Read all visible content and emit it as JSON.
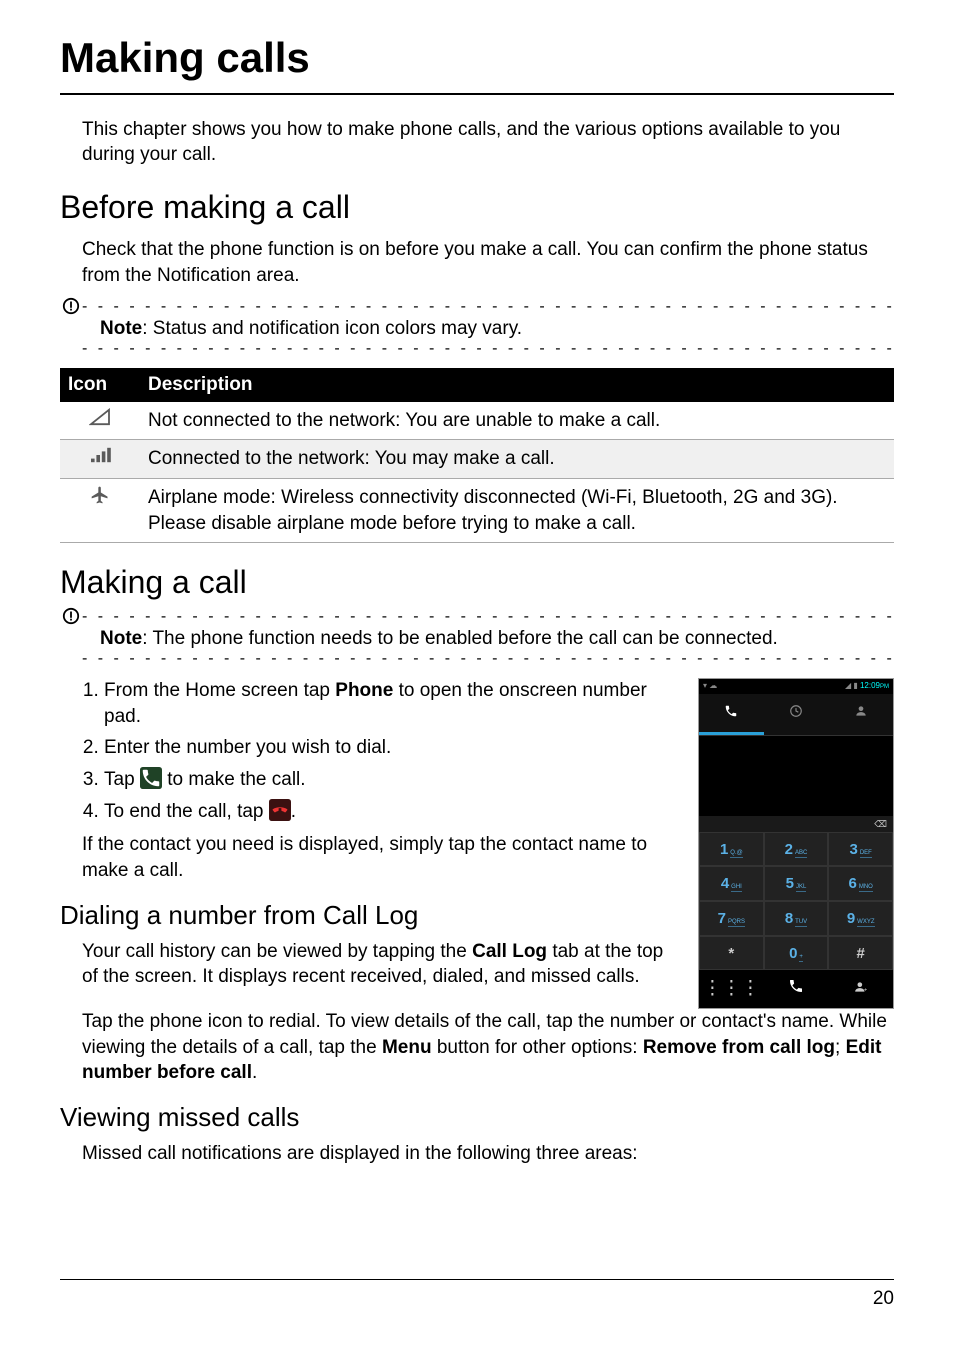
{
  "title": "Making calls",
  "intro": "This chapter shows you how to make phone calls, and the various options available to you during your call.",
  "section_before": {
    "heading": "Before making a call",
    "body": "Check that the phone function is on before you make a call. You can confirm the phone status from the Notification area.",
    "note_label": "Note",
    "note_text": ": Status and notification icon colors may vary."
  },
  "table": {
    "h1": "Icon",
    "h2": "Description",
    "r1": "Not connected to the network: You are unable to make a call.",
    "r2": "Connected to the network: You may make a call.",
    "r3": "Airplane mode: Wireless connectivity disconnected (Wi-Fi, Bluetooth, 2G and 3G). Please disable airplane mode before trying to make a call."
  },
  "section_making": {
    "heading": "Making a call",
    "note_label": "Note",
    "note_text": ": The phone function needs to be enabled before the call can be connected.",
    "step1a": "From the Home screen tap ",
    "step1_bold": "Phone",
    "step1b": " to open the onscreen number pad.",
    "step2": "Enter the number you wish to dial.",
    "step3a": "Tap ",
    "step3b": " to make the call.",
    "step4a": "To end the call, tap ",
    "step4b": ".",
    "after_steps": "If the contact you need is displayed, simply tap the contact name to make a call."
  },
  "section_calllog": {
    "heading": "Dialing a number from Call Log",
    "p1a": "Your call history can be viewed by tapping the ",
    "p1_bold": "Call Log",
    "p1b": " tab at the top of the screen. It displays recent received, dialed, and missed calls.",
    "p2a": "Tap the phone icon to redial. To view details of the call, tap the number or contact's name. While viewing the details of a call, tap the ",
    "p2_bold1": "Menu",
    "p2b": " button for other options: ",
    "p2_bold2": "Remove from call log",
    "p2c": "; ",
    "p2_bold3": "Edit number before call",
    "p2d": "."
  },
  "section_missed": {
    "heading": "Viewing missed calls",
    "body": "Missed call notifications are displayed in the following three areas:"
  },
  "dialer": {
    "time": "12:09",
    "ampm": "PM",
    "backspace": "⌫",
    "keys": [
      {
        "n": "1",
        "l": "Q.@"
      },
      {
        "n": "2",
        "l": "ABC"
      },
      {
        "n": "3",
        "l": "DEF"
      },
      {
        "n": "4",
        "l": "GHI"
      },
      {
        "n": "5",
        "l": "JKL"
      },
      {
        "n": "6",
        "l": "MNO"
      },
      {
        "n": "7",
        "l": "PQRS"
      },
      {
        "n": "8",
        "l": "TUV"
      },
      {
        "n": "9",
        "l": "WXYZ"
      },
      {
        "n": "*",
        "l": ""
      },
      {
        "n": "0",
        "l": "+"
      },
      {
        "n": "#",
        "l": ""
      }
    ],
    "grid_icon": "⋮⋮⋮",
    "contact_add": "👤"
  },
  "page_number": "20"
}
